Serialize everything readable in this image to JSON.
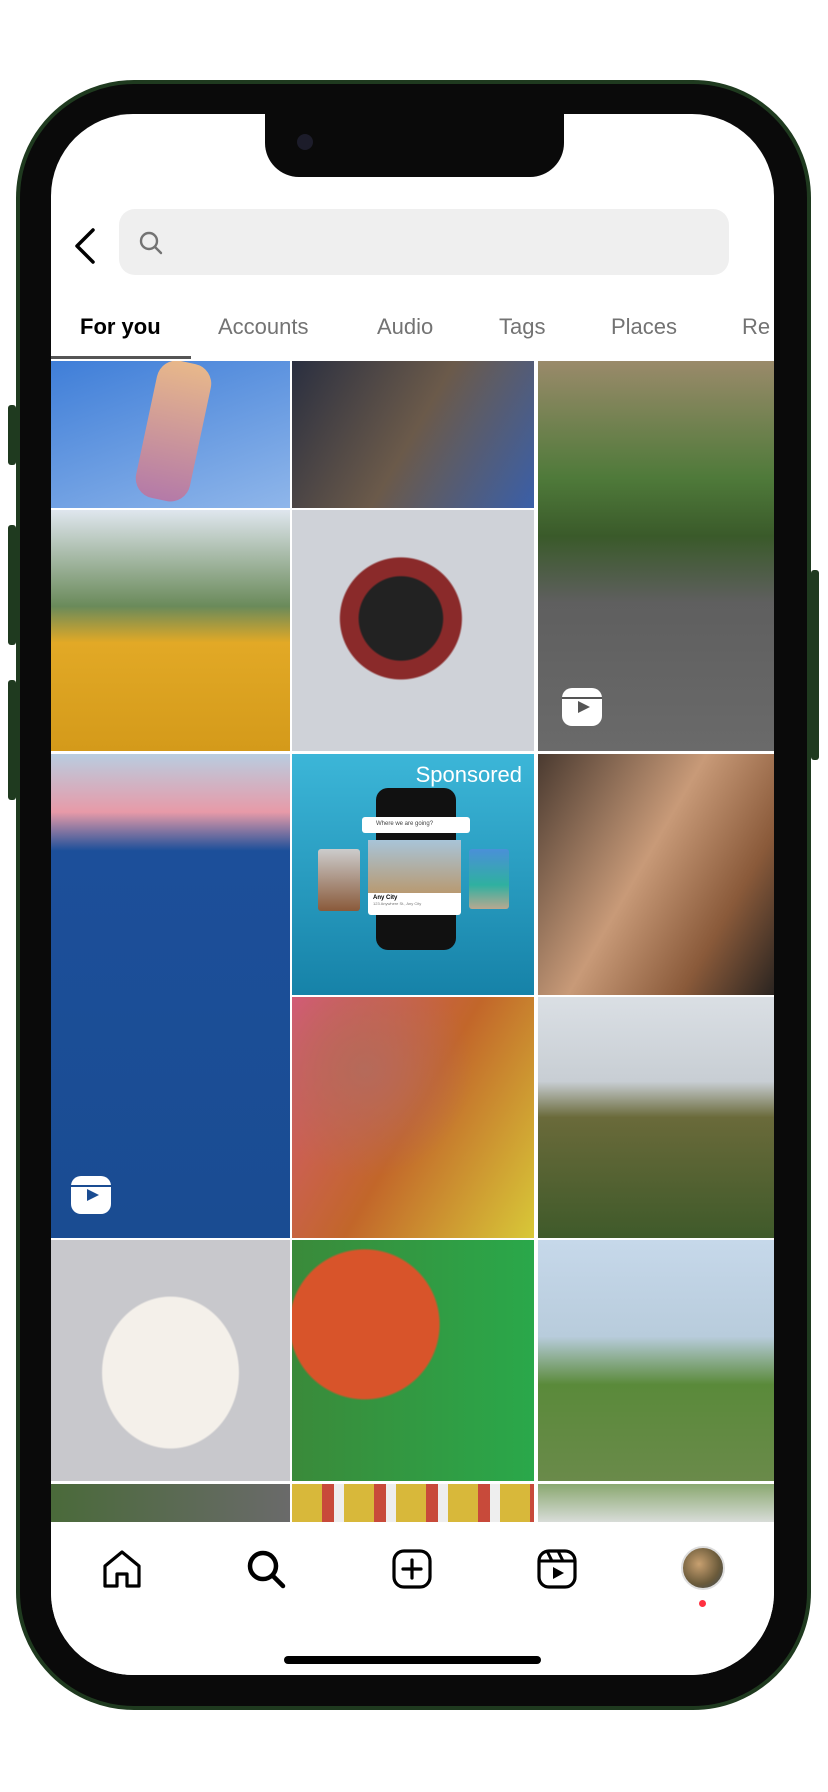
{
  "search": {
    "placeholder": ""
  },
  "tabs": [
    {
      "label": "For you",
      "active": true
    },
    {
      "label": "Accounts"
    },
    {
      "label": "Audio"
    },
    {
      "label": "Tags"
    },
    {
      "label": "Places"
    },
    {
      "label": "Re"
    }
  ],
  "grid": {
    "sponsored_label": "Sponsored",
    "ad": {
      "search_text": "Where we are going?",
      "city": "Any City",
      "address": "123 Anywhere St., Any City"
    }
  },
  "nav": {
    "items": [
      "home-icon",
      "search-icon",
      "create-icon",
      "reels-icon",
      "profile-avatar"
    ],
    "notification_dot_color": "#ff3040"
  },
  "colors": {
    "frame": "#1f3a1f",
    "accent": "#000000"
  }
}
